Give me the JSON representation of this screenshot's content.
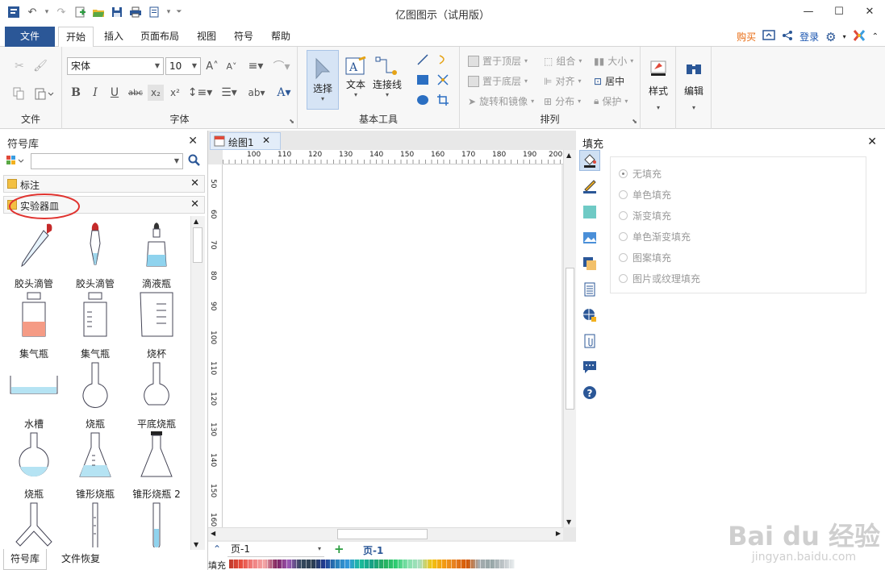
{
  "app": {
    "title": "亿图图示（试用版）",
    "window_controls": [
      "—",
      "☐",
      "✕"
    ]
  },
  "menu": {
    "tabs": [
      "文件",
      "开始",
      "插入",
      "页面布局",
      "视图",
      "符号",
      "帮助"
    ],
    "active": "开始",
    "buy": "购买",
    "login": "登录"
  },
  "ribbon": {
    "groups": {
      "file": "文件",
      "font": "字体",
      "tools": "基本工具",
      "arrange": "排列"
    },
    "font_name": "宋体",
    "font_size": "10",
    "tools": {
      "select": "选择",
      "text": "文本",
      "connector": "连接线"
    },
    "arrange": {
      "bring_front": "置于顶层",
      "send_back": "置于底层",
      "rotate": "旋转和镜像",
      "group": "组合",
      "align": "对齐",
      "distribute": "分布",
      "size": "大小",
      "center": "居中",
      "protect": "保护"
    },
    "style": "样式",
    "edit": "编辑"
  },
  "library": {
    "title": "符号库",
    "search_placeholder": "",
    "sections": [
      "标注",
      "实验器皿"
    ],
    "shapes": [
      "胶头滴管",
      "胶头滴管",
      "滴液瓶",
      "集气瓶",
      "集气瓶",
      "烧杯",
      "水槽",
      "烧瓶",
      "平底烧瓶",
      "烧瓶",
      "锥形烧瓶",
      "锥形烧瓶 2",
      "",
      "",
      ""
    ],
    "bottom_tabs": [
      "符号库",
      "文件恢复"
    ]
  },
  "document": {
    "tab": "绘图1",
    "hruler": [
      "100",
      "110",
      "120",
      "130",
      "140",
      "150",
      "160",
      "170",
      "180",
      "190",
      "200"
    ],
    "vruler": [
      "50",
      "60",
      "70",
      "80",
      "90",
      "100",
      "110",
      "120",
      "130",
      "140",
      "150",
      "160"
    ],
    "page_select": "页-1",
    "page_tab": "页-1",
    "fill_label": "填充"
  },
  "fill_panel": {
    "title": "填充",
    "options": [
      "无填充",
      "单色填充",
      "渐变填充",
      "单色渐变填充",
      "图案填充",
      "图片或纹理填充"
    ],
    "selected": "无填充"
  },
  "watermark": {
    "brand": "Bai du 经验",
    "url": "jingyan.baidu.com"
  },
  "colors": {
    "accent": "#2b5797",
    "buy": "#e86a10",
    "highlight_ring": "#e0332f"
  }
}
